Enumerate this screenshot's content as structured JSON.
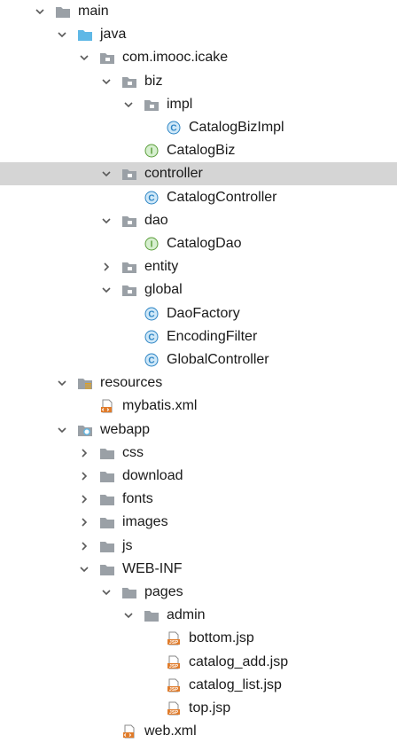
{
  "tree": {
    "nodes": [
      {
        "name": "main",
        "depth": 0,
        "arrow": "down",
        "icon": "folder-gray-icon"
      },
      {
        "name": "java",
        "depth": 1,
        "arrow": "down",
        "icon": "folder-blue-icon"
      },
      {
        "name": "com.imooc.icake",
        "depth": 2,
        "arrow": "down",
        "icon": "package-icon"
      },
      {
        "name": "biz",
        "depth": 3,
        "arrow": "down",
        "icon": "package-icon"
      },
      {
        "name": "impl",
        "depth": 4,
        "arrow": "down",
        "icon": "package-icon"
      },
      {
        "name": "CatalogBizImpl",
        "depth": 5,
        "arrow": "none",
        "icon": "class-icon"
      },
      {
        "name": "CatalogBiz",
        "depth": 4,
        "arrow": "none",
        "icon": "interface-icon"
      },
      {
        "name": "controller",
        "depth": 3,
        "arrow": "down",
        "icon": "package-icon",
        "selected": true
      },
      {
        "name": "CatalogController",
        "depth": 4,
        "arrow": "none",
        "icon": "class-icon"
      },
      {
        "name": "dao",
        "depth": 3,
        "arrow": "down",
        "icon": "package-icon"
      },
      {
        "name": "CatalogDao",
        "depth": 4,
        "arrow": "none",
        "icon": "interface-icon"
      },
      {
        "name": "entity",
        "depth": 3,
        "arrow": "right",
        "icon": "package-icon"
      },
      {
        "name": "global",
        "depth": 3,
        "arrow": "down",
        "icon": "package-icon"
      },
      {
        "name": "DaoFactory",
        "depth": 4,
        "arrow": "none",
        "icon": "class-icon"
      },
      {
        "name": "EncodingFilter",
        "depth": 4,
        "arrow": "none",
        "icon": "class-icon"
      },
      {
        "name": "GlobalController",
        "depth": 4,
        "arrow": "none",
        "icon": "class-icon"
      },
      {
        "name": "resources",
        "depth": 1,
        "arrow": "down",
        "icon": "resources-folder-icon"
      },
      {
        "name": "mybatis.xml",
        "depth": 2,
        "arrow": "none",
        "icon": "xml-file-icon"
      },
      {
        "name": "webapp",
        "depth": 1,
        "arrow": "down",
        "icon": "web-folder-icon"
      },
      {
        "name": "css",
        "depth": 2,
        "arrow": "right",
        "icon": "folder-gray-icon"
      },
      {
        "name": "download",
        "depth": 2,
        "arrow": "right",
        "icon": "folder-gray-icon"
      },
      {
        "name": "fonts",
        "depth": 2,
        "arrow": "right",
        "icon": "folder-gray-icon"
      },
      {
        "name": "images",
        "depth": 2,
        "arrow": "right",
        "icon": "folder-gray-icon"
      },
      {
        "name": "js",
        "depth": 2,
        "arrow": "right",
        "icon": "folder-gray-icon"
      },
      {
        "name": "WEB-INF",
        "depth": 2,
        "arrow": "down",
        "icon": "folder-gray-icon"
      },
      {
        "name": "pages",
        "depth": 3,
        "arrow": "down",
        "icon": "folder-gray-icon"
      },
      {
        "name": "admin",
        "depth": 4,
        "arrow": "down",
        "icon": "folder-gray-icon"
      },
      {
        "name": "bottom.jsp",
        "depth": 5,
        "arrow": "none",
        "icon": "jsp-file-icon"
      },
      {
        "name": "catalog_add.jsp",
        "depth": 5,
        "arrow": "none",
        "icon": "jsp-file-icon"
      },
      {
        "name": "catalog_list.jsp",
        "depth": 5,
        "arrow": "none",
        "icon": "jsp-file-icon"
      },
      {
        "name": "top.jsp",
        "depth": 5,
        "arrow": "none",
        "icon": "jsp-file-icon"
      },
      {
        "name": "web.xml",
        "depth": 3,
        "arrow": "none",
        "icon": "webxml-file-icon"
      }
    ]
  },
  "icon_text": {
    "class_letter": "C",
    "interface_letter": "I",
    "jsp_badge": "JSP"
  },
  "colors": {
    "selected_row": "#d5d5d5",
    "arrow": "#5a5a5a",
    "folder_gray": "#9aa0a6",
    "folder_blue": "#5fb8e6",
    "class_fill": "#cfe8f8",
    "class_letter": "#2c84c4",
    "interface_fill": "#d6efcf",
    "interface_letter": "#5a9e3a",
    "jsp_orange": "#e07b2a"
  }
}
